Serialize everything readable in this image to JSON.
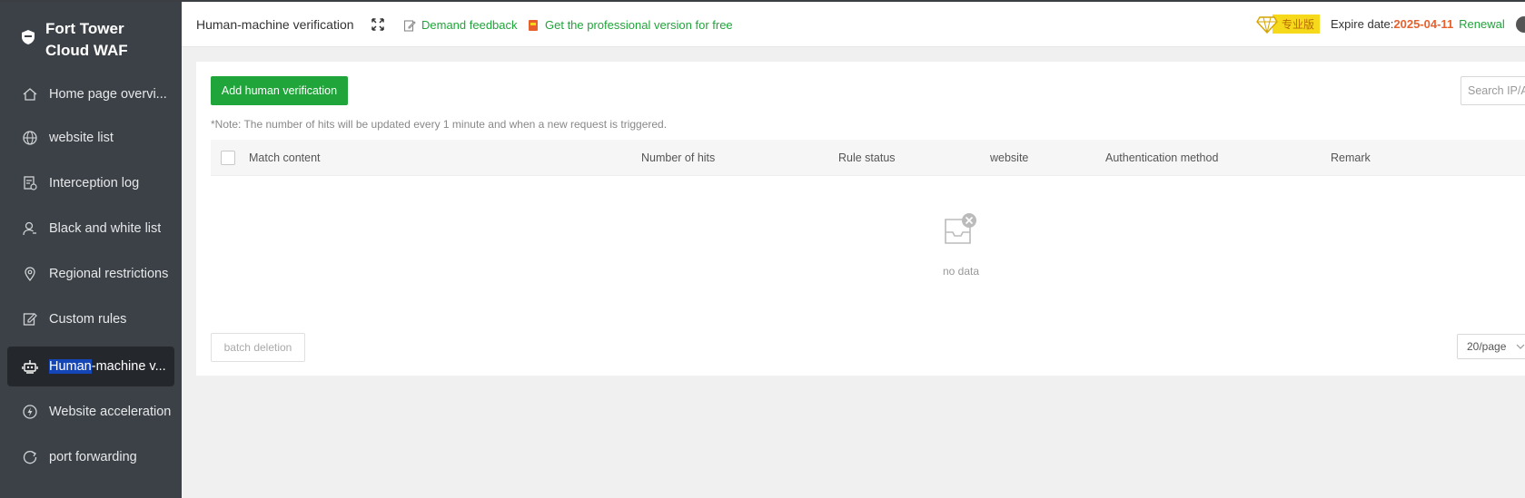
{
  "app": {
    "name": "Fort Tower Cloud WAF"
  },
  "sidebar": {
    "items": [
      {
        "label": "Home page overvi...",
        "icon": "home-icon"
      },
      {
        "label": "website list",
        "icon": "globe-icon"
      },
      {
        "label": "Interception log",
        "icon": "log-icon"
      },
      {
        "label": "Black and white list",
        "icon": "user-icon"
      },
      {
        "label": "Regional restrictions",
        "icon": "location-icon"
      },
      {
        "label": "Custom rules",
        "icon": "edit-icon"
      },
      {
        "label_selected": "Human",
        "label_rest": "-machine v...",
        "icon": "robot-icon",
        "active": true
      },
      {
        "label": "Website acceleration",
        "icon": "lightning-icon"
      },
      {
        "label": "port forwarding",
        "icon": "forward-icon"
      }
    ]
  },
  "header": {
    "title": "Human-machine verification",
    "feedback_label": "Demand feedback",
    "pro_label": "Get the professional version for free",
    "badge_label": "专业版",
    "expire_label": "Expire date:",
    "expire_date": "2025-04-11",
    "renew_label": "Renewal"
  },
  "main": {
    "add_button": "Add human verification",
    "search_placeholder": "Search IP/Ad",
    "note": "*Note: The number of hits will be updated every 1 minute and when a new request is triggered.",
    "columns": [
      "Match content",
      "Number of hits",
      "Rule status",
      "website",
      "Authentication method",
      "Remark"
    ],
    "empty_text": "no data",
    "batch_delete": "batch deletion",
    "page_size": "20/page"
  },
  "colors": {
    "accent": "#20a53a",
    "sidebar_bg": "#3c4147",
    "expire_date": "#e8602c",
    "badge_bg": "#f5d91a"
  }
}
